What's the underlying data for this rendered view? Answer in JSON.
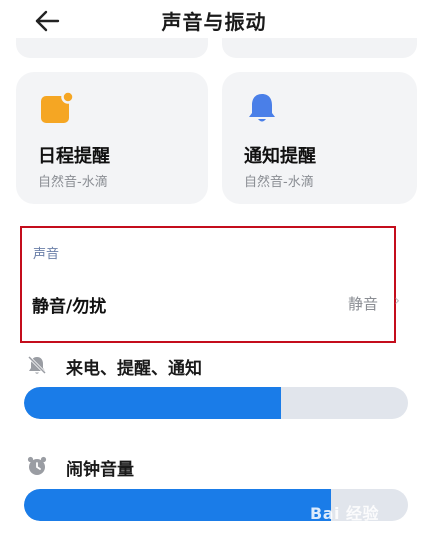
{
  "header": {
    "title": "声音与振动",
    "back_icon": "back-arrow-icon"
  },
  "cards": [
    {
      "title": "日程提醒",
      "subtitle": "自然音-水滴",
      "icon": "calendar-reminder-icon",
      "icon_color": "#f5a623"
    },
    {
      "title": "通知提醒",
      "subtitle": "自然音-水滴",
      "icon": "bell-icon",
      "icon_color": "#4a7fe8"
    }
  ],
  "sound_section": {
    "label": "声音",
    "mute_row": {
      "title": "静音/勿扰",
      "value": "静音",
      "chevron": "›"
    }
  },
  "volumes": {
    "ring": {
      "label": "来电、提醒、通知",
      "icon": "ringer-muted-icon",
      "level": 0.67
    },
    "alarm": {
      "label": "闹钟音量",
      "icon": "alarm-clock-icon",
      "level": 0.8
    }
  },
  "colors": {
    "accent": "#1a7ce8",
    "track": "#e1e5ec",
    "card_bg": "#f3f4f6",
    "highlight_box": "#c40d1c"
  },
  "watermark": {
    "text": "Bai 经验"
  }
}
